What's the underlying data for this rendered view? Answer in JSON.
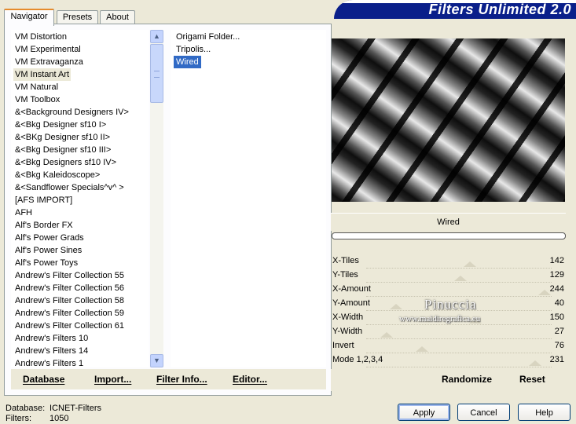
{
  "tabs": [
    "Navigator",
    "Presets",
    "About"
  ],
  "app_title": "Filters Unlimited 2.0",
  "categories": [
    "VM Distortion",
    "VM Experimental",
    "VM Extravaganza",
    "VM Instant Art",
    "VM Natural",
    "VM Toolbox",
    "&<Background Designers IV>",
    "&<Bkg Designer sf10 I>",
    "&<BKg Designer sf10 II>",
    "&<Bkg Designer sf10 III>",
    "&<Bkg Designers sf10 IV>",
    "&<Bkg Kaleidoscope>",
    "&<Sandflower Specials^v^ >",
    "[AFS IMPORT]",
    "AFH",
    "Alf's Border FX",
    "Alf's Power Grads",
    "Alf's Power Sines",
    "Alf's Power Toys",
    "Andrew's Filter Collection 55",
    "Andrew's Filter Collection 56",
    "Andrew's Filter Collection 58",
    "Andrew's Filter Collection 59",
    "Andrew's Filter Collection 61",
    "Andrew's Filters 10",
    "Andrew's Filters 14",
    "Andrew's Filters 1"
  ],
  "selected_category": "VM Instant Art",
  "filters": [
    "Origami Folder...",
    "Tripolis...",
    "Wired"
  ],
  "selected_filter": "Wired",
  "bottom_buttons": {
    "database": "Database",
    "import": "Import...",
    "filter_info": "Filter Info...",
    "editor": "Editor..."
  },
  "filter_name": "Wired",
  "progress": 0,
  "params": [
    {
      "label": "X-Tiles",
      "value": "142",
      "level": 0.56
    },
    {
      "label": "Y-Tiles",
      "value": "129",
      "level": 0.51
    },
    {
      "label": "X-Amount",
      "value": "244",
      "level": 0.96
    },
    {
      "label": "Y-Amount",
      "value": "40",
      "level": 0.16
    },
    {
      "label": "X-Width",
      "value": "150",
      "level": 0.59
    },
    {
      "label": "Y-Width",
      "value": "27",
      "level": 0.11
    },
    {
      "label": "Invert",
      "value": "76",
      "level": 0.3
    },
    {
      "label": "Mode 1,2,3,4",
      "value": "231",
      "level": 0.91
    }
  ],
  "right_buttons": {
    "randomize": "Randomize",
    "reset": "Reset"
  },
  "watermark": {
    "name": "Pinuccia",
    "url": "www.maidiregrafica.eu"
  },
  "status": {
    "database_label": "Database:",
    "database_value": "ICNET-Filters",
    "filters_label": "Filters:",
    "filters_value": "1050"
  },
  "dialog_buttons": {
    "apply": "Apply",
    "cancel": "Cancel",
    "help": "Help"
  }
}
